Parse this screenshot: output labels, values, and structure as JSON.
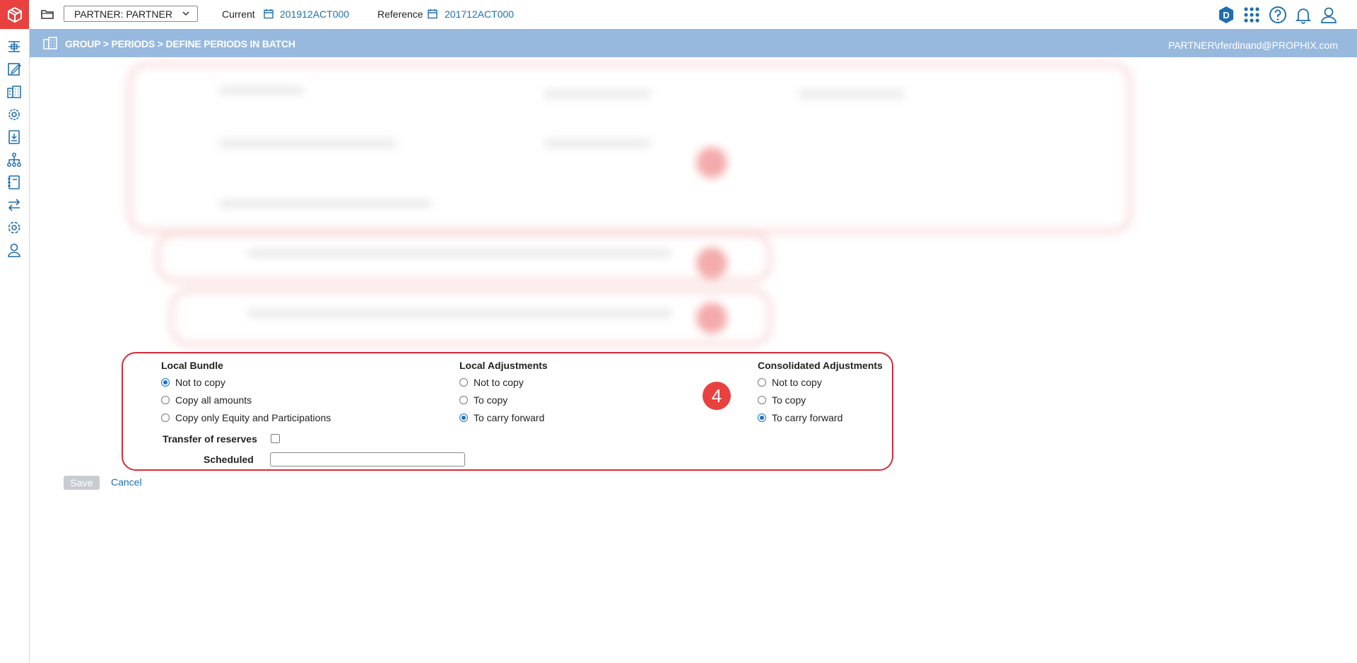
{
  "topbar": {
    "partner_select": "PARTNER: PARTNER",
    "current_label": "Current",
    "current_value": "201912ACT000",
    "reference_label": "Reference",
    "reference_value": "201712ACT000",
    "badge_letter": "D"
  },
  "header": {
    "breadcrumb": "GROUP > PERIODS > DEFINE PERIODS IN BATCH",
    "user": "PARTNER\\rferdinand@PROPHIX.com"
  },
  "form": {
    "local_bundle": {
      "title": "Local Bundle",
      "options": [
        {
          "label": "Not to copy",
          "selected": true
        },
        {
          "label": "Copy all amounts",
          "selected": false
        },
        {
          "label": "Copy only Equity and Participations",
          "selected": false
        }
      ]
    },
    "local_adjustments": {
      "title": "Local Adjustments",
      "options": [
        {
          "label": "Not to copy",
          "selected": false
        },
        {
          "label": "To copy",
          "selected": false
        },
        {
          "label": "To carry forward",
          "selected": true
        }
      ]
    },
    "consolidated_adjustments": {
      "title": "Consolidated Adjustments",
      "options": [
        {
          "label": "Not to copy",
          "selected": false
        },
        {
          "label": "To copy",
          "selected": false
        },
        {
          "label": "To carry forward",
          "selected": true
        }
      ]
    },
    "transfer_of_reserves_label": "Transfer of reserves",
    "transfer_of_reserves_checked": false,
    "scheduled_label": "Scheduled",
    "scheduled_value": ""
  },
  "step_marker": "4",
  "actions": {
    "save_label": "Save",
    "cancel_label": "Cancel"
  },
  "colors": {
    "brand_red": "#e8413f",
    "header_band": "#98b9de",
    "link_blue": "#1f6fae",
    "highlight_border": "#d62b39"
  }
}
